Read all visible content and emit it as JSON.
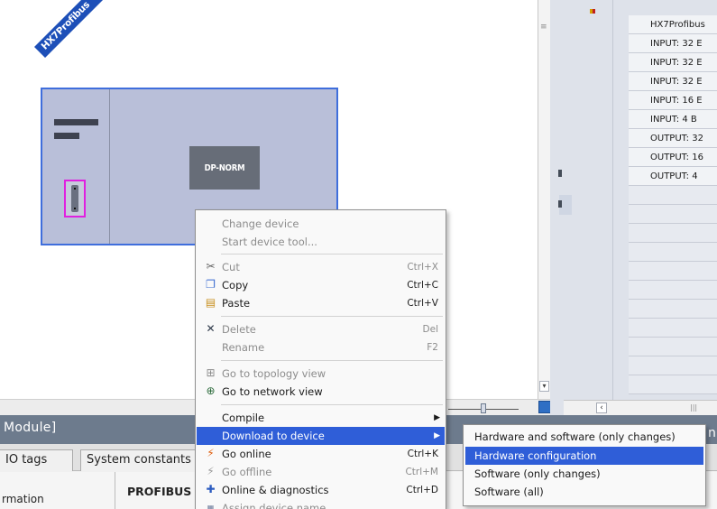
{
  "device": {
    "name": "HX7Profibus",
    "module_label": "DP-NORM"
  },
  "io_table": {
    "rows": [
      "HX7Profibus",
      "INPUT:  32 E",
      "INPUT:  32 E",
      "INPUT:  32 E",
      "INPUT:  16 E",
      "INPUT:   4 B",
      "OUTPUT: 32",
      "OUTPUT: 16",
      "OUTPUT:  4"
    ]
  },
  "context_menu": {
    "change_device": "Change device",
    "start_device_tool": "Start device tool...",
    "cut": "Cut",
    "cut_shortcut": "Ctrl+X",
    "copy": "Copy",
    "copy_shortcut": "Ctrl+C",
    "paste": "Paste",
    "paste_shortcut": "Ctrl+V",
    "delete": "Delete",
    "delete_shortcut": "Del",
    "rename": "Rename",
    "rename_shortcut": "F2",
    "goto_topology": "Go to topology view",
    "goto_network": "Go to network view",
    "compile": "Compile",
    "download": "Download to device",
    "go_online": "Go online",
    "go_online_shortcut": "Ctrl+K",
    "go_offline": "Go offline",
    "go_offline_shortcut": "Ctrl+M",
    "online_diag": "Online & diagnostics",
    "online_diag_shortcut": "Ctrl+D",
    "assign_name": "Assign device name"
  },
  "download_submenu": {
    "hw_sw_changes": "Hardware and software (only changes)",
    "hw_config": "Hardware configuration",
    "sw_changes": "Software (only changes)",
    "sw_all": "Software (all)"
  },
  "inspector": {
    "title": "Module]",
    "title_tail": "n",
    "tab_io_tags": "IO tags",
    "tab_system_constants": "System constants",
    "info_left": "rmation",
    "info_profibus": "PROFIBUS"
  },
  "colors": {
    "highlight": "#2f5ed8",
    "device_border": "#3f6edc",
    "device_tag": "#1d4fb8",
    "port_highlight": "#e020e0"
  }
}
